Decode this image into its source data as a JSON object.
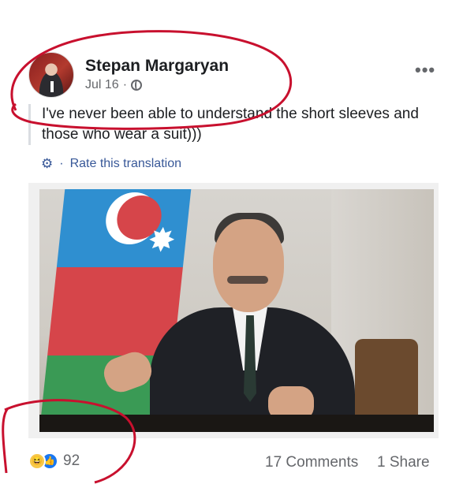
{
  "post": {
    "author": "Stepan Margaryan",
    "date": "Jul 16",
    "separator": "·",
    "more": "•••",
    "text": "I've never been able to understand the short sleeves and those who wear a suit)))",
    "translation_link": "Rate this translation",
    "translation_separator": "·"
  },
  "footer": {
    "reaction_count": "92",
    "comments": "17 Comments",
    "shares": "1 Share"
  },
  "icons": {
    "reaction_1": "haha-icon",
    "reaction_2": "like-icon",
    "privacy": "globe-icon",
    "settings": "gear-icon"
  },
  "colors": {
    "link": "#385898",
    "annotation": "#c8102e",
    "meta_text": "#65676b"
  }
}
